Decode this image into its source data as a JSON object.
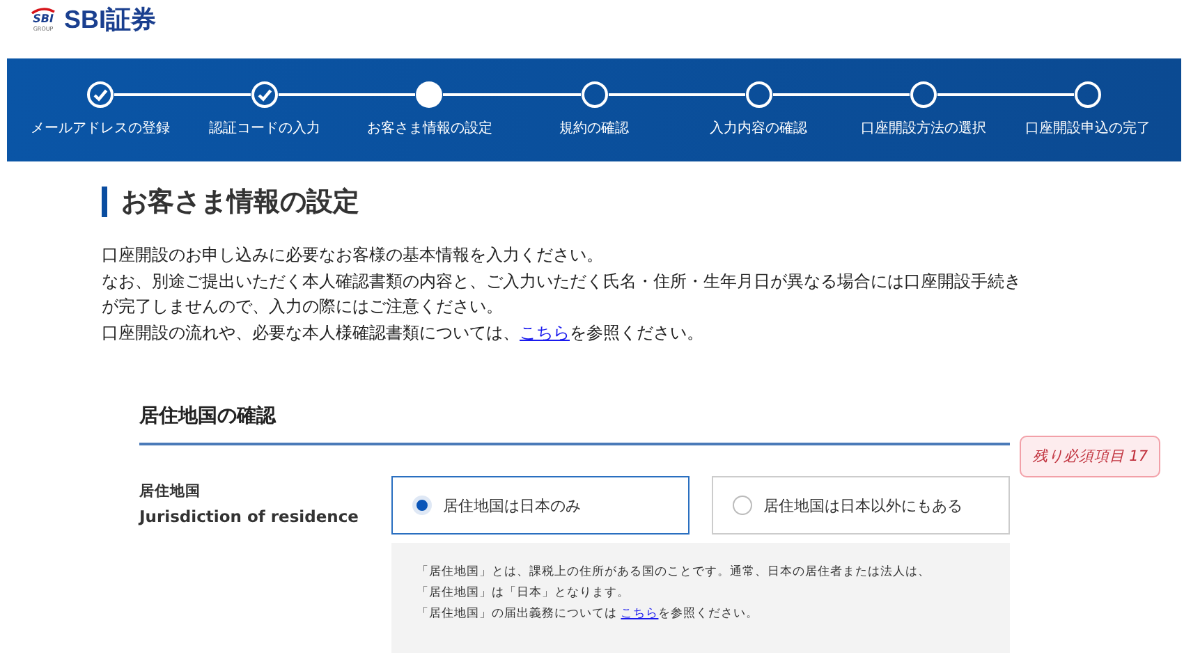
{
  "logo": {
    "mark": "SBI",
    "group": "GROUP",
    "name": "SBI証券"
  },
  "steps": [
    {
      "label": "メールアドレスの登録",
      "kind": "done"
    },
    {
      "label": "認証コードの入力",
      "kind": "done"
    },
    {
      "label": "お客さま情報の設定",
      "kind": "current"
    },
    {
      "label": "規約の確認",
      "kind": "todo"
    },
    {
      "label": "入力内容の確認",
      "kind": "todo"
    },
    {
      "label": "口座開設方法の選択",
      "kind": "todo"
    },
    {
      "label": "口座開設申込の完了",
      "kind": "todo"
    }
  ],
  "heading": "お客さま情報の設定",
  "intro": [
    "口座開設のお申し込みに必要なお客様の基本情報を入力ください。",
    "なお、別途ご提出いただく本人確認書類の内容と、ご入力いただく氏名・住所・生年月日が異なる場合には口座開設手続きが完了しませんので、入力の際にはご注意ください。"
  ],
  "intro_link_line": {
    "before": "口座開設の流れや、必要な本人様確認書類については、",
    "link": "こちら",
    "after": "を参照ください。"
  },
  "section": {
    "title": "居住地国の確認",
    "badge": "残り必須項目 17",
    "field": {
      "label": "居住地国",
      "label_en": "Jurisdiction of residence",
      "options": [
        {
          "label": "居住地国は日本のみ",
          "selected": true
        },
        {
          "label": "居住地国は日本以外にもある",
          "selected": false
        }
      ],
      "note": [
        "「居住地国」とは、課税上の住所がある国のことです。通常、日本の居住者または法人は、",
        "「居住地国」は「日本」となります。"
      ],
      "note_link_line": {
        "before": "「居住地国」の届出義務については ",
        "link": "こちら",
        "after": "を参照ください。"
      }
    }
  }
}
